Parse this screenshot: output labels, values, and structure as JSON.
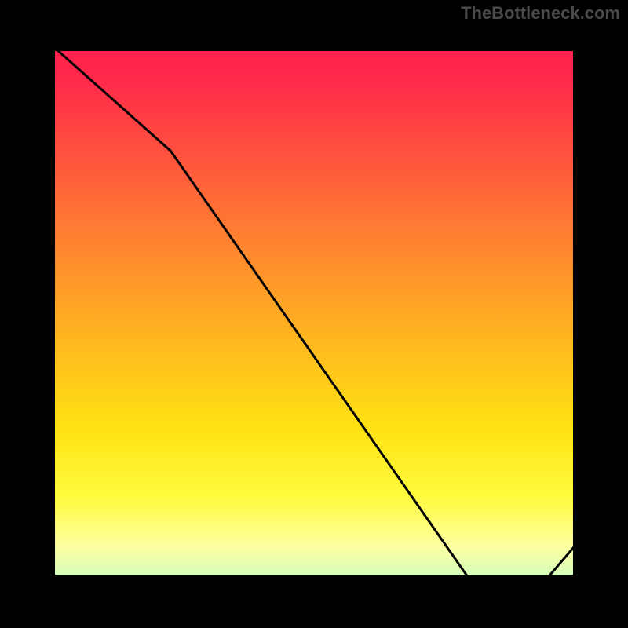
{
  "watermark": "TheBottleneck.com",
  "chart_data": {
    "type": "line",
    "title": "",
    "xlabel": "",
    "ylabel": "",
    "x": [
      0,
      25,
      80,
      87,
      100
    ],
    "values": [
      100,
      78,
      0,
      0,
      15
    ],
    "xlim": [
      0,
      100
    ],
    "ylim": [
      0,
      100
    ],
    "annotation_label": "",
    "annotation_x_range": [
      80,
      87
    ],
    "background": "red-yellow-green vertical gradient",
    "line_color": "#000000",
    "valley_band_y_range": [
      95,
      100
    ]
  },
  "colors": {
    "frame": "#000000",
    "watermark": "#4a4a4a",
    "marker": "#c0392b"
  }
}
